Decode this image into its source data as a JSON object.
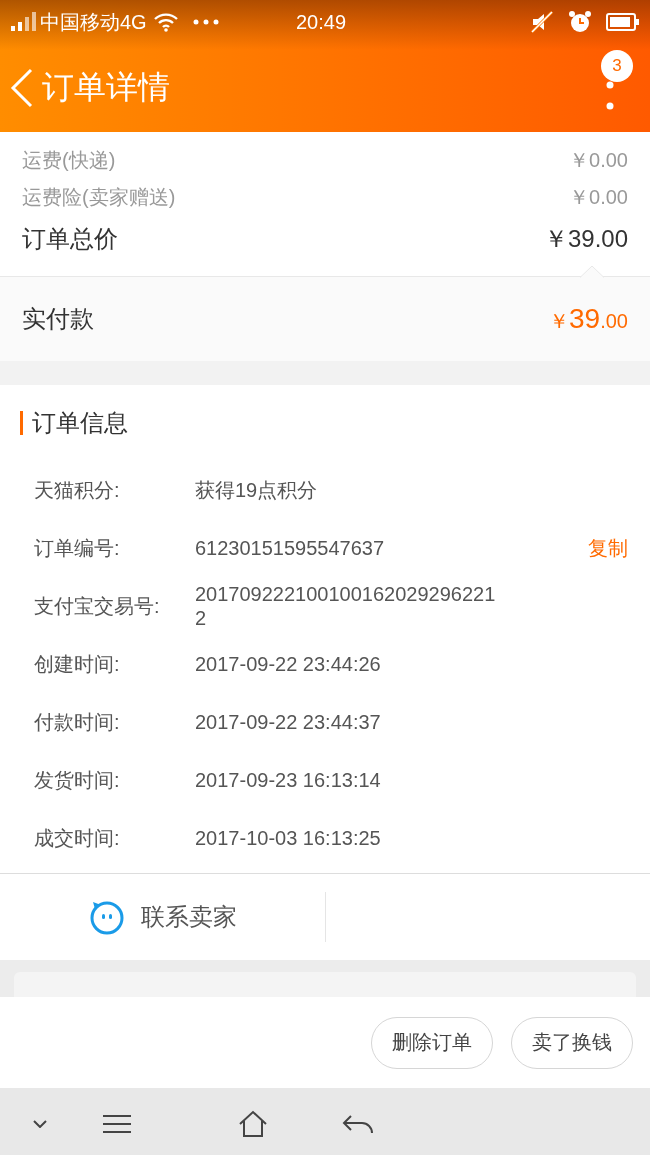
{
  "status_bar": {
    "carrier": "中国移动4G",
    "time": "20:49"
  },
  "header": {
    "title": "订单详情",
    "badge": "3"
  },
  "fees": [
    {
      "label": "运费(快递)",
      "value": "￥0.00"
    },
    {
      "label": "运费险(卖家赠送)",
      "value": "￥0.00"
    }
  ],
  "total": {
    "label": "订单总价",
    "value": "￥39.00"
  },
  "paid": {
    "label": "实付款",
    "currency": "￥",
    "integer": "39",
    "decimal": ".00"
  },
  "order_info": {
    "title": "订单信息",
    "rows": [
      {
        "label": "天猫积分:",
        "value": "获得19点积分"
      },
      {
        "label": "订单编号:",
        "value": "61230151595547637",
        "action": "复制"
      },
      {
        "label": "支付宝交易号:",
        "value": "2017092221001001620292962212"
      },
      {
        "label": "创建时间:",
        "value": "2017-09-22 23:44:26"
      },
      {
        "label": "付款时间:",
        "value": "2017-09-22 23:44:37"
      },
      {
        "label": "发货时间:",
        "value": "2017-09-23 16:13:14"
      },
      {
        "label": "成交时间:",
        "value": "2017-10-03 16:13:25"
      }
    ]
  },
  "contact": {
    "label": "联系卖家"
  },
  "buttons": [
    "删除订单",
    "卖了换钱"
  ]
}
